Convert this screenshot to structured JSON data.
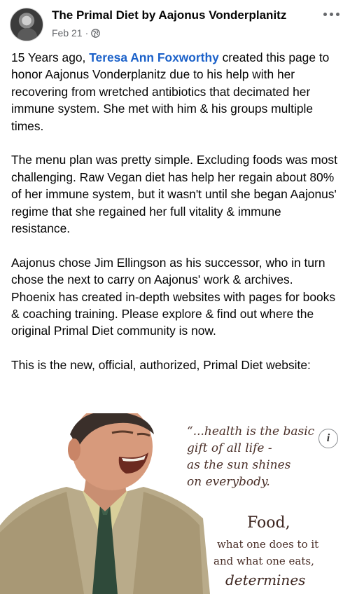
{
  "header": {
    "page_name": "The Primal Diet by Aajonus Vonderplanitz",
    "date": "Feb 21",
    "separator": "·"
  },
  "post": {
    "p1_pre": "15 Years ago, ",
    "p1_mention": "Teresa Ann Foxworthy",
    "p1_post": " created this page to honor Aajonus Vonderplanitz due to his help with her recovering from wretched antibiotics that decimated her immune system. She met with him & his groups multiple times.",
    "p2": "The menu plan was pretty simple. Excluding foods was most challenging. Raw Vegan diet has help her regain about 80% of her immune system, but it wasn't until she began Aajonus' regime that she regained her full vitality & immune resistance.",
    "p3": "Aajonus chose Jim Ellingson as his successor, who in turn chose the next to carry on Aajonus' work & archives. Phoenix has created in-depth websites with pages for books & coaching training. Please explore & find out where the original Primal Diet community is now.",
    "p4": "This is the new, official, authorized, Primal Diet website:"
  },
  "attachment": {
    "info_icon_glyph": "i",
    "quote_lines": [
      "“...health is the basic",
      "gift of all life -",
      "as the sun shines",
      "on everybody.",
      "Food,",
      "what one does to it",
      "and what one eats,",
      "determines"
    ]
  },
  "colors": {
    "mention": "#1b61c9",
    "meta": "#65676b",
    "quote_text": "#4a2f28"
  },
  "icons": [
    "avatar",
    "globe-icon",
    "more-icon",
    "info-icon"
  ]
}
